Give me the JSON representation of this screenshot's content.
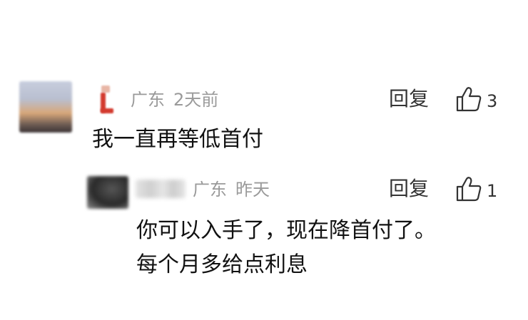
{
  "comment": {
    "location": "广东",
    "time": "2天前",
    "reply_label": "回复",
    "like_count": "3",
    "text": "我一直再等低首付"
  },
  "reply": {
    "location": "广东",
    "time": "昨天",
    "reply_label": "回复",
    "like_count": "1",
    "text_line1": "你可以入手了，现在降首付了。",
    "text_line2": "每个月多给点利息"
  },
  "icons": {
    "like": "thumbs-up-icon"
  },
  "colors": {
    "meta_text": "#9a9a9a",
    "body_text": "#111111",
    "action_text": "#333333"
  }
}
